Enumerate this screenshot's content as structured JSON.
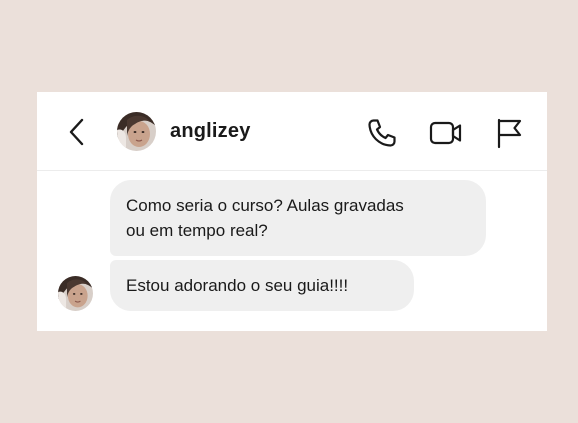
{
  "header": {
    "username": "anglizey",
    "icons": {
      "back": "chevron-left-icon",
      "phone": "phone-icon",
      "video": "video-camera-icon",
      "flag": "flag-icon"
    }
  },
  "messages": [
    {
      "lines": [
        "Como seria o curso? Aulas gravadas",
        "ou em tempo real?"
      ]
    },
    {
      "lines": [
        "Estou adorando o seu guia!!!!"
      ]
    }
  ],
  "colors": {
    "page_background": "#ebe0da",
    "card_background": "#ffffff",
    "bubble_background": "#efefef",
    "text": "#1a1a1a"
  }
}
